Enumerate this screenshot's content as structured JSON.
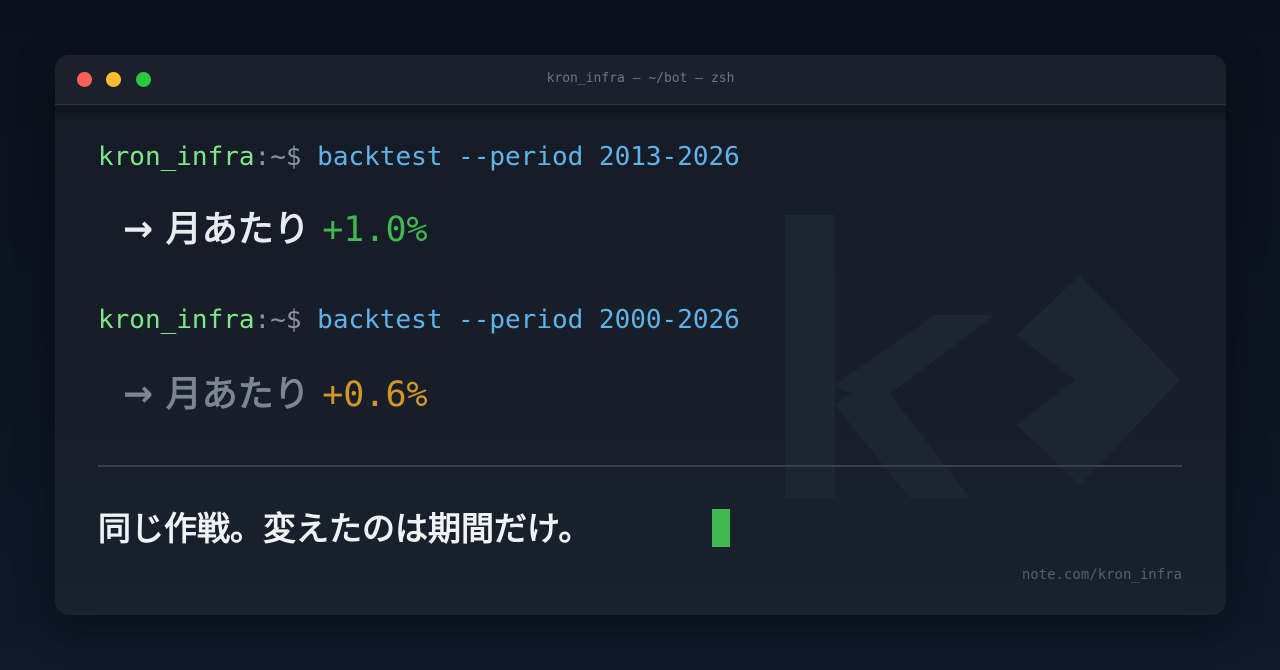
{
  "window": {
    "title": "kron_infra — ~/bot — zsh"
  },
  "terminal": {
    "lines": [
      {
        "user": "kron_infra",
        "path": ":~$ ",
        "command": "backtest --period 2013-2026",
        "result_prefix": "→ 月あたり ",
        "result_value": "+1.0%"
      },
      {
        "user": "kron_infra",
        "path": ":~$ ",
        "command": "backtest --period 2000-2026",
        "result_prefix": "→ 月あたり ",
        "result_value": "+0.6%"
      }
    ],
    "conclusion": "同じ作戦。変えたのは期間だけ。"
  },
  "footer": {
    "watermark": "note.com/kron_infra"
  },
  "colors": {
    "user": "#7ee787",
    "command": "#5fb3ea",
    "positive": "#3fb950",
    "warning": "#d29922",
    "cursor": "#3fb950"
  },
  "icons": {
    "window_controls": [
      "close-dot",
      "minimize-dot",
      "maximize-dot"
    ],
    "logo": "k-chevron-logo-icon"
  }
}
